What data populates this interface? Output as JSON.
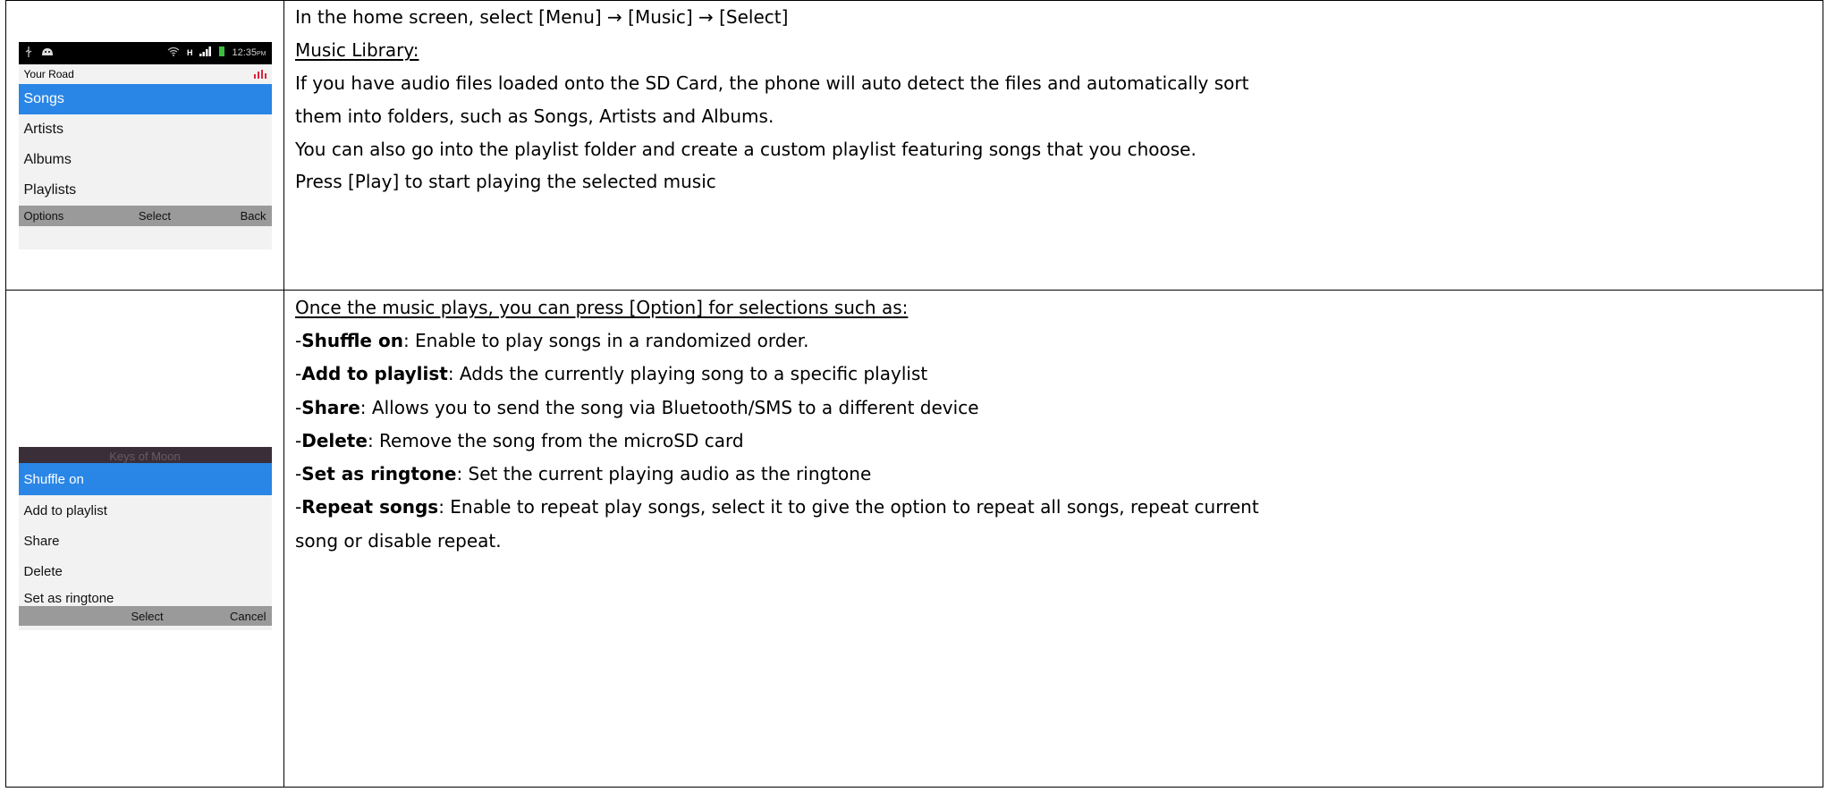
{
  "section1": {
    "phone": {
      "status_time": "12:35",
      "status_ampm": "PM",
      "status_network": "H",
      "title": "Your Road",
      "menu": [
        "Songs",
        "Artists",
        "Albums",
        "Playlists"
      ],
      "softkeys": {
        "left": "Options",
        "center": "Select",
        "right": "Back"
      }
    },
    "lines": {
      "l1": "In the home screen, select [Menu] → [Music] → [Select]",
      "l2": "Music Library:",
      "l3": "If you have audio files loaded onto the SD Card, the phone will auto detect the files and automatically sort",
      "l4": "them into folders, such as Songs, Artists and Albums.",
      "l5": "You can also go into the playlist folder and create a custom playlist featuring songs that you choose.",
      "l6": "Press [Play] to start playing the selected music"
    }
  },
  "section2": {
    "phone": {
      "header": "Keys of Moon",
      "items": [
        "Shuffle on",
        "Add to playlist",
        "Share",
        "Delete",
        "Set as ringtone"
      ],
      "softkeys": {
        "center": "Select",
        "right": "Cancel"
      }
    },
    "intro": "Once the music plays, you can press [Option] for selections such as:",
    "options": [
      {
        "name": "Shuffle on",
        "desc": ": Enable to play songs in a randomized order."
      },
      {
        "name": "Add to playlist",
        "desc": ": Adds the currently playing song to a specific playlist"
      },
      {
        "name": "Share",
        "desc": ": Allows you to send the song via Bluetooth/SMS to a different device"
      },
      {
        "name": "Delete",
        "desc": ": Remove the song from the microSD card"
      },
      {
        "name": "Set as ringtone",
        "desc": ": Set the current playing audio as the ringtone"
      },
      {
        "name": "Repeat songs",
        "desc": ": Enable to repeat play songs, select it to give the option to repeat all songs, repeat current"
      }
    ],
    "continuation": "song or disable repeat.",
    "dash": "- "
  }
}
